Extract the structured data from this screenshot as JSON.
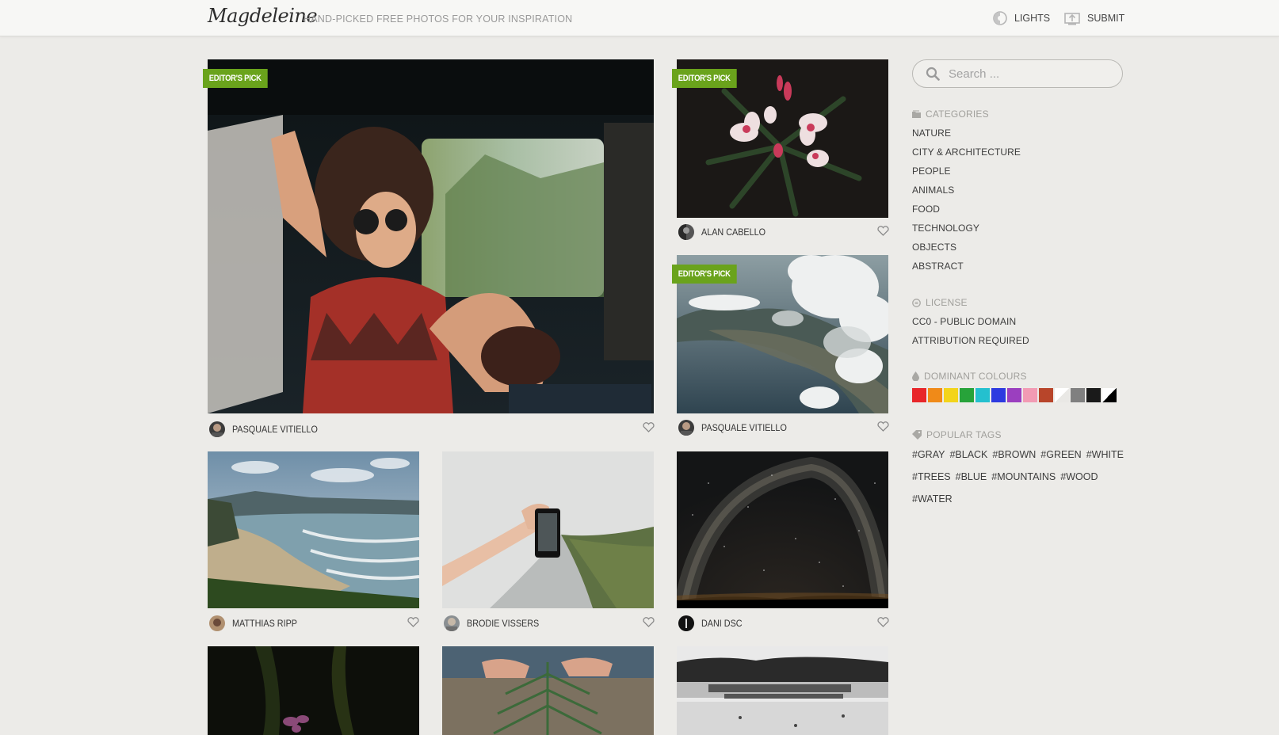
{
  "header": {
    "logo": "Magdeleine",
    "tagline": "HAND-PICKED FREE PHOTOS FOR YOUR INSPIRATION",
    "lights_label": "LIGHTS",
    "submit_label": "SUBMIT"
  },
  "photos": [
    {
      "badge": "EDITOR'S PICK",
      "author": "PASQUALE VITIELLO",
      "subject": "woman in car with camera"
    },
    {
      "badge": "EDITOR'S PICK",
      "author": "ALAN CABELLO",
      "subject": "pink flowers on dark background"
    },
    {
      "badge": "EDITOR'S PICK",
      "author": "PASQUALE VITIELLO",
      "subject": "aerial coast with clouds"
    },
    {
      "author": "MATTHIAS RIPP",
      "subject": "beach with waves"
    },
    {
      "author": "BRODIE VISSERS",
      "subject": "hand holding phone over river"
    },
    {
      "author": "DANI DSC",
      "subject": "milky way night sky"
    },
    {
      "subject": "dark flower"
    },
    {
      "subject": "hands holding fern"
    },
    {
      "subject": "black and white beach"
    }
  ],
  "search": {
    "placeholder": "Search ..."
  },
  "sidebar": {
    "categories_title": "CATEGORIES",
    "categories": [
      "NATURE",
      "CITY & ARCHITECTURE",
      "PEOPLE",
      "ANIMALS",
      "FOOD",
      "TECHNOLOGY",
      "OBJECTS",
      "ABSTRACT"
    ],
    "license_title": "LICENSE",
    "licenses": [
      "CC0 - PUBLIC DOMAIN",
      "ATTRIBUTION REQUIRED"
    ],
    "colours_title": "DOMINANT COLOURS",
    "colours": [
      "#e8262a",
      "#f08a18",
      "#f3d41a",
      "#27a33a",
      "#24c0cf",
      "#2d3ae0",
      "#9b3fbf",
      "#f29bb4",
      "#b8452a",
      "#ffffff",
      "#808080",
      "#1a1a1a",
      "black-white"
    ],
    "tags_title": "POPULAR TAGS",
    "tag_rows": [
      [
        "#GRAY",
        "#BLACK",
        "#BROWN",
        "#GREEN",
        "#WHITE"
      ],
      [
        "#TREES",
        "#BLUE",
        "#MOUNTAINS",
        "#WOOD"
      ],
      [
        "#WATER"
      ]
    ]
  }
}
